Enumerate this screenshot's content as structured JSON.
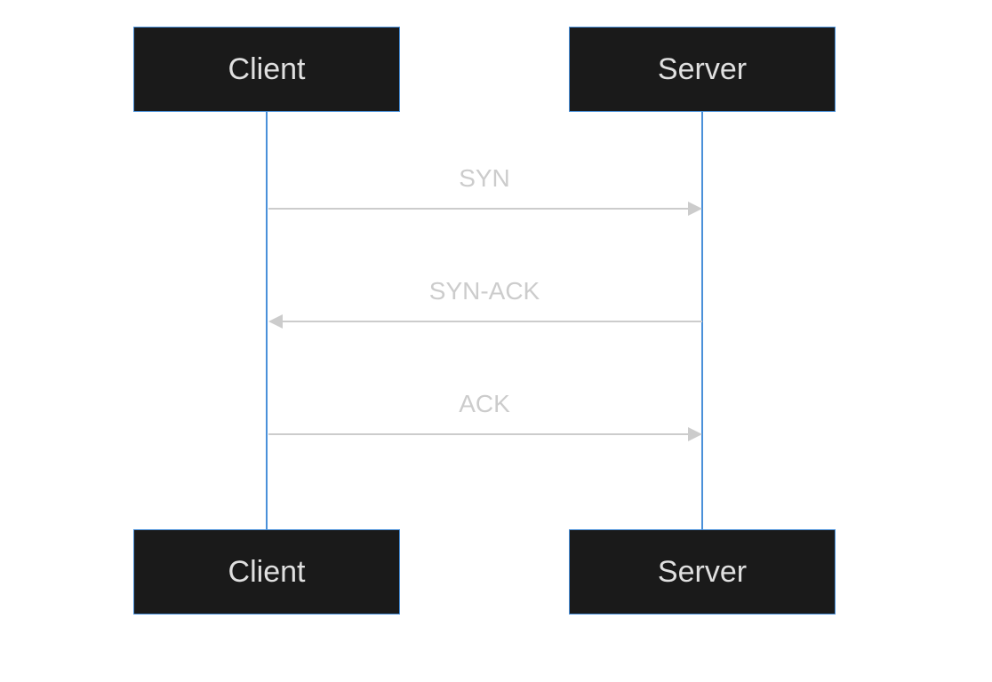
{
  "diagram": {
    "type": "sequence",
    "participants": [
      {
        "id": "client",
        "label": "Client"
      },
      {
        "id": "server",
        "label": "Server"
      }
    ],
    "messages": [
      {
        "from": "client",
        "to": "server",
        "label": "SYN",
        "direction": "right"
      },
      {
        "from": "server",
        "to": "client",
        "label": "SYN-ACK",
        "direction": "left"
      },
      {
        "from": "client",
        "to": "server",
        "label": "ACK",
        "direction": "right"
      }
    ],
    "colors": {
      "box_bg": "#1a1a1a",
      "box_border": "#4a90d9",
      "box_text": "#e0e0e0",
      "lifeline": "#4a90d9",
      "arrow": "#cccccc",
      "label": "#cccccc"
    }
  }
}
